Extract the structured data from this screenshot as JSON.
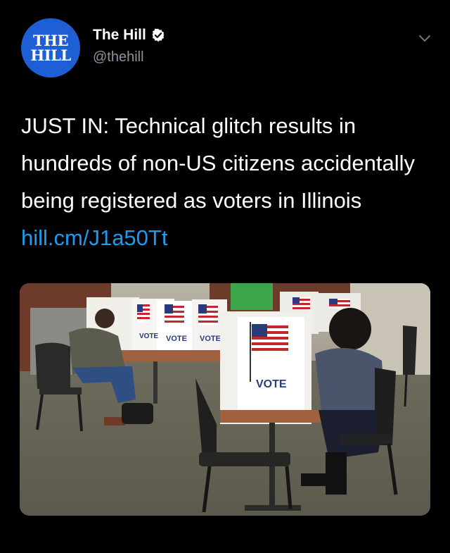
{
  "account": {
    "avatar_line1": "THE",
    "avatar_line2": "HILL",
    "display_name": "The Hill",
    "handle": "@thehill",
    "verified": true
  },
  "tweet": {
    "text": "JUST IN: Technical glitch results in hundreds of non-US citizens accidentally being registered as voters in Illinois",
    "link": "hill.cm/J1a50Tt"
  },
  "media": {
    "booth_labels": [
      "VOTE",
      "VOTE",
      "VOTE",
      "VOTE"
    ]
  },
  "icons": {
    "verified": "verified-badge-icon",
    "caret": "chevron-down-icon"
  },
  "colors": {
    "background": "#000000",
    "link": "#1d9bf0",
    "avatar": "#1f5fd6",
    "handle": "#8b949e"
  }
}
